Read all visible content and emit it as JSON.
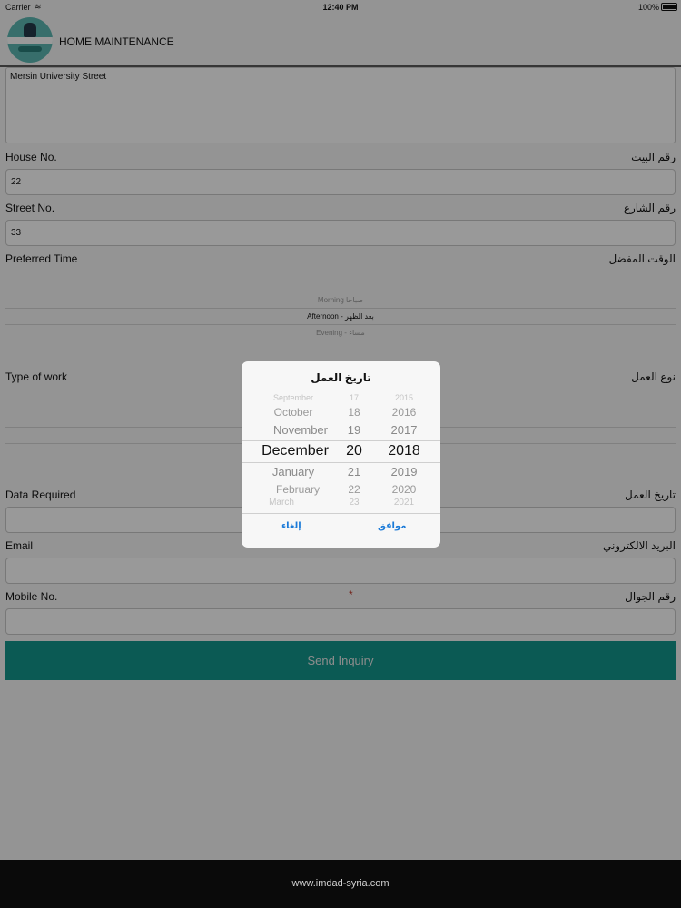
{
  "status_bar": {
    "carrier": "Carrier",
    "time": "12:40 PM",
    "battery": "100%"
  },
  "header": {
    "title": "HOME MAINTENANCE"
  },
  "form": {
    "address_value": "Mersin University Street",
    "house_no": {
      "label_en": "House No.",
      "label_ar": "رقم البيت",
      "value": "22"
    },
    "street_no": {
      "label_en": "Street No.",
      "label_ar": "رقم الشارع",
      "value": "33"
    },
    "preferred_time": {
      "label_en": "Preferred Time",
      "label_ar": "الوقت المفضل",
      "options": [
        "Morning صباحا",
        "Afternoon - بعد الظهر",
        "Evening - مساء"
      ],
      "selected": "Afternoon - بعد الظهر"
    },
    "type_of_work": {
      "label_en": "Type of work",
      "label_ar": "نوع العمل"
    },
    "date_required": {
      "label_en": "Data Required",
      "label_ar": "تاريخ العمل",
      "value": ""
    },
    "email": {
      "label_en": "Email",
      "label_ar": "البريد الالكتروني",
      "value": ""
    },
    "mobile": {
      "label_en": "Mobile No.",
      "label_ar": "رقم الجوال",
      "required_mark": "*",
      "value": ""
    },
    "submit_label": "Send Inquiry"
  },
  "date_dialog": {
    "title": "تاريخ العمل",
    "months": [
      "September",
      "October",
      "November",
      "December",
      "January",
      "February",
      "March"
    ],
    "days": [
      "17",
      "18",
      "19",
      "20",
      "21",
      "22",
      "23"
    ],
    "years": [
      "2015",
      "2016",
      "2017",
      "2018",
      "2019",
      "2020",
      "2021"
    ],
    "selected": {
      "month": "December",
      "day": "20",
      "year": "2018"
    },
    "cancel_label": "إلغاء",
    "ok_label": "موافق"
  },
  "footer": {
    "text": "www.imdad-syria.com"
  },
  "colors": {
    "accent": "#13978d",
    "link": "#1a7ad8",
    "required": "#c0392b"
  }
}
